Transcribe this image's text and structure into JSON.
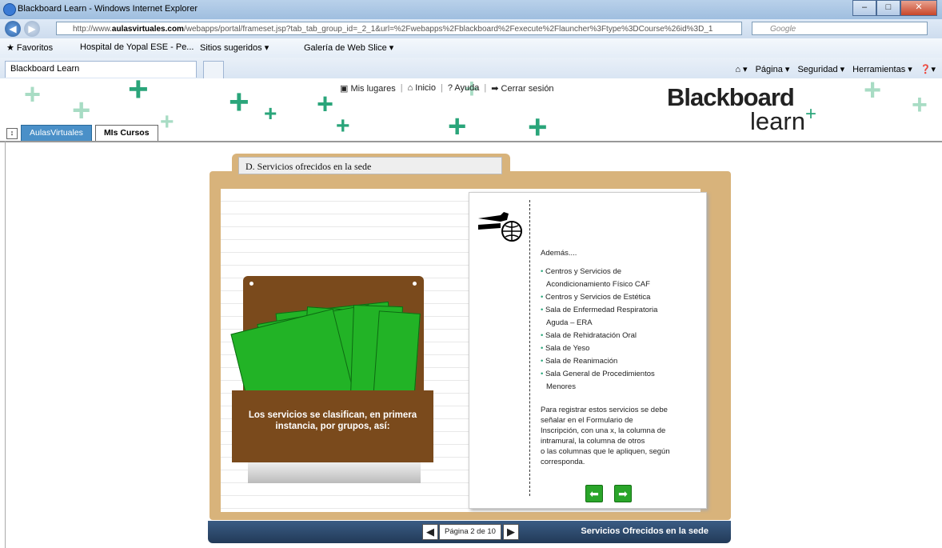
{
  "window": {
    "title": "Blackboard Learn - Windows Internet Explorer",
    "min": "–",
    "max": "□",
    "close": "✕"
  },
  "address": {
    "url_prefix": "http://www.",
    "url_domain": "aulasvirtuales.com",
    "url_rest": "/webapps/portal/frameset.jsp?tab_tab_group_id=_2_1&url=%2Fwebapps%2Fblackboard%2Fexecute%2Flauncher%3Ftype%3DCourse%26id%3D_1",
    "search_placeholder": "Google"
  },
  "favorites": {
    "label": "Favoritos",
    "items": [
      "Hospital de Yopal ESE - Pe...",
      "Sitios sugeridos ▾",
      "Galería de Web Slice ▾"
    ]
  },
  "tab": {
    "title": "Blackboard Learn"
  },
  "commandbar": {
    "pagina": "Página ▾",
    "seguridad": "Seguridad ▾",
    "herramientas": "Herramientas ▾"
  },
  "bb_header": {
    "links": {
      "mis_lugares": "Mis lugares",
      "inicio": "Inicio",
      "ayuda": "Ayuda",
      "cerrar": "Cerrar sesión"
    },
    "logo_top": "Blackboard",
    "logo_bottom": "learn",
    "tabs": [
      "AulasVirtuales",
      "MIs Cursos"
    ]
  },
  "lesson": {
    "label": "D. Servicios ofrecidos en la sede",
    "box_text": "Los servicios se clasifican, en primera instancia, por grupos, así:",
    "note_heading": "Además....",
    "services": [
      [
        "Centros y Servicios de",
        "Acondicionamiento Físico CAF"
      ],
      [
        "Centros y Servicios de Estética"
      ],
      [
        "Sala de Enfermedad Respiratoria",
        "Aguda – ERA"
      ],
      [
        "Sala de Rehidratación Oral"
      ],
      [
        "Sala de Yeso"
      ],
      [
        "Sala de Reanimación"
      ],
      [
        "Sala General de Procedimientos",
        "Menores"
      ]
    ],
    "note_paragraph": [
      "Para registrar estos servicios se debe",
      "señalar en el Formulario de",
      "Inscripción, con una x, la columna de",
      "intramural, la columna de otros",
      "o las columnas que le apliquen, según",
      "corresponda."
    ]
  },
  "footer": {
    "page": "Página 2 de 10",
    "title": "Servicios Ofrecidos en la sede"
  },
  "colors": {
    "accent_green": "#2aa57a",
    "folder": "#d8b37b",
    "box_brown": "#7a4a1c",
    "footer_blue": "#223a58"
  },
  "icons": [
    "ie-icon",
    "back-icon",
    "forward-icon",
    "home-icon",
    "help-icon",
    "logout-icon",
    "hand-globe-icon",
    "prev-arrow-icon",
    "next-arrow-icon"
  ]
}
